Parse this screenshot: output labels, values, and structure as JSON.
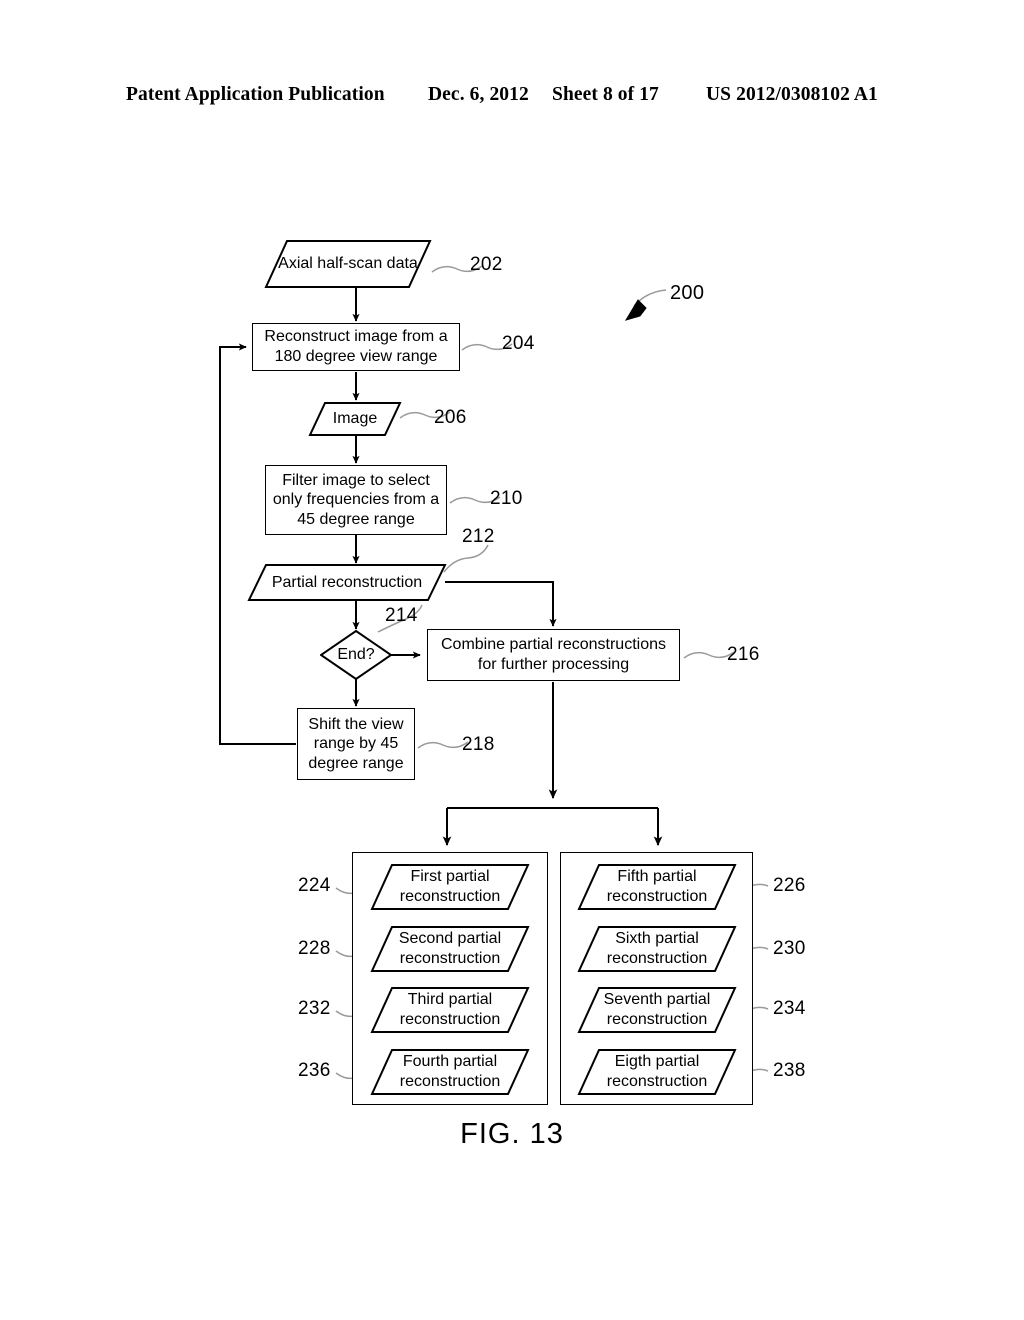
{
  "header": {
    "left": "Patent Application Publication",
    "date": "Dec. 6, 2012",
    "sheet": "Sheet 8 of 17",
    "number": "US 2012/0308102 A1"
  },
  "figure": {
    "caption": "FIG. 13",
    "diagram_ref": "200"
  },
  "nodes": {
    "axial_data": {
      "label": "Axial half-scan data",
      "ref": "202",
      "shape": "parallelogram"
    },
    "reconstruct": {
      "label": "Reconstruct image from a 180 degree view range",
      "ref": "204",
      "shape": "process"
    },
    "image": {
      "label": "Image",
      "ref": "206",
      "shape": "parallelogram"
    },
    "filter": {
      "label": "Filter image to select only frequencies from a 45 degree range",
      "ref": "210",
      "shape": "process"
    },
    "partial": {
      "label": "Partial reconstruction",
      "ref": "212",
      "shape": "parallelogram"
    },
    "end_decision": {
      "label": "End?",
      "ref": "214",
      "shape": "decision"
    },
    "combine": {
      "label": "Combine partial reconstructions for further processing",
      "ref": "216",
      "shape": "process"
    },
    "shift": {
      "label": "Shift the view range by 45 degree range",
      "ref": "218",
      "shape": "process"
    }
  },
  "results": {
    "left_column": [
      {
        "label": "First partial reconstruction",
        "ref": "224"
      },
      {
        "label": "Second partial reconstruction",
        "ref": "228"
      },
      {
        "label": "Third partial reconstruction",
        "ref": "232"
      },
      {
        "label": "Fourth partial reconstruction",
        "ref": "236"
      }
    ],
    "right_column": [
      {
        "label": "Fifth partial reconstruction",
        "ref": "226"
      },
      {
        "label": "Sixth partial reconstruction",
        "ref": "230"
      },
      {
        "label": "Seventh partial reconstruction",
        "ref": "234"
      },
      {
        "label": "Eigth partial reconstruction",
        "ref": "238"
      }
    ]
  },
  "colors": {
    "ink": "#000000",
    "paper": "#ffffff",
    "leader": "#9a9a9a"
  }
}
